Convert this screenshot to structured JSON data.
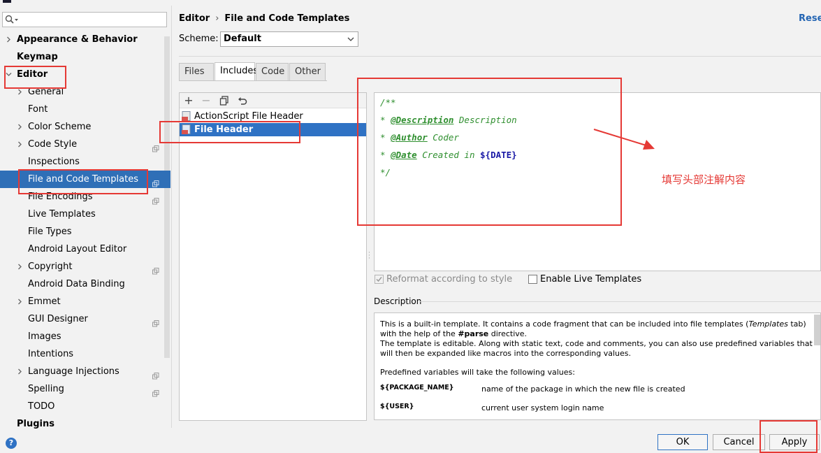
{
  "sidebar": {
    "search_placeholder": "",
    "items": [
      {
        "label": "Appearance & Behavior",
        "bold": true,
        "expandable": true,
        "expanded": false
      },
      {
        "label": "Keymap",
        "bold": true
      },
      {
        "label": "Editor",
        "bold": true,
        "expandable": true,
        "expanded": true
      },
      {
        "label": "General",
        "expandable": true
      },
      {
        "label": "Font"
      },
      {
        "label": "Color Scheme",
        "expandable": true
      },
      {
        "label": "Code Style",
        "expandable": true,
        "copy_icon": true
      },
      {
        "label": "Inspections"
      },
      {
        "label": "File and Code Templates",
        "selected": true,
        "copy_icon": true
      },
      {
        "label": "File Encodings",
        "copy_icon": true
      },
      {
        "label": "Live Templates"
      },
      {
        "label": "File Types"
      },
      {
        "label": "Android Layout Editor"
      },
      {
        "label": "Copyright",
        "expandable": true,
        "copy_icon": true
      },
      {
        "label": "Android Data Binding"
      },
      {
        "label": "Emmet",
        "expandable": true
      },
      {
        "label": "GUI Designer",
        "copy_icon": true
      },
      {
        "label": "Images"
      },
      {
        "label": "Intentions"
      },
      {
        "label": "Language Injections",
        "expandable": true,
        "copy_icon": true
      },
      {
        "label": "Spelling",
        "copy_icon": true
      },
      {
        "label": "TODO"
      },
      {
        "label": "Plugins",
        "bold": true
      }
    ]
  },
  "header": {
    "breadcrumb_root": "Editor",
    "breadcrumb_sep": "›",
    "breadcrumb_page": "File and Code Templates",
    "reset_label": "Reset"
  },
  "scheme": {
    "label": "Scheme:",
    "value": "Default"
  },
  "tabs": [
    {
      "label": "Files"
    },
    {
      "label": "Includes",
      "active": true
    },
    {
      "label": "Code"
    },
    {
      "label": "Other"
    }
  ],
  "toolbar": {
    "add": "+",
    "remove": "−"
  },
  "templates": [
    {
      "name": "ActionScript File Header"
    },
    {
      "name": "File Header",
      "selected": true
    }
  ],
  "editor": {
    "line1": "/**",
    "l2_prefix": "* ",
    "l2_tag": "@Description",
    "l2_text": " Description",
    "l3_prefix": "* ",
    "l3_tag": "@Author",
    "l3_text": " Coder",
    "l4_prefix": "* ",
    "l4_tag": "@Date",
    "l4_text": " Created in ",
    "l4_var": "${DATE}",
    "line5": "*/"
  },
  "options": {
    "reformat_label": "Reformat according to style",
    "reformat_checked": true,
    "reformat_disabled": true,
    "live_label": "Enable Live Templates",
    "live_checked": false
  },
  "description": {
    "title": "Description",
    "p1_a": "This is a built-in template. It contains a code fragment that can be included into file templates (",
    "p1_em": "Templates",
    "p1_b": " tab) with the help of the ",
    "p1_bold": "#parse",
    "p1_c": " directive.",
    "p2": "The template is editable. Along with static text, code and comments, you can also use predefined variables that will then be expanded like macros into the corresponding values.",
    "p3": "Predefined variables will take the following values:",
    "vars": [
      {
        "name": "${PACKAGE_NAME}",
        "desc": "name of the package in which the new file is created"
      },
      {
        "name": "${USER}",
        "desc": "current user system login name"
      }
    ]
  },
  "buttons": {
    "ok": "OK",
    "cancel": "Cancel",
    "apply": "Apply"
  },
  "help_label": "?",
  "annotation": "填写头部注解内容",
  "colors": {
    "selection": "#2f6fb7",
    "annotation_red": "#e53935",
    "link_blue": "#2465b3"
  }
}
